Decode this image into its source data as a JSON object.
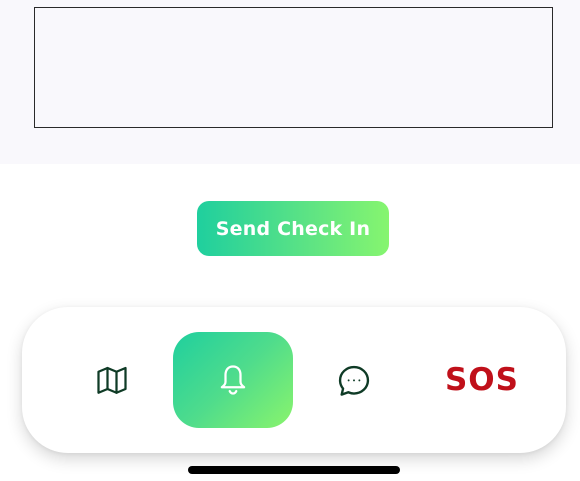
{
  "main": {
    "message_box_text": "",
    "checkin_button_label": "Send Check In"
  },
  "nav": {
    "items": [
      {
        "icon": "map-icon",
        "selected": false
      },
      {
        "icon": "bell-icon",
        "selected": true
      },
      {
        "icon": "chat-bubble-icon",
        "selected": false
      },
      {
        "label": "SOS",
        "selected": false
      }
    ]
  },
  "colors": {
    "accent_gradient_start": "#1fcf9e",
    "accent_gradient_end": "#86f56f",
    "sos_red": "#c0101a",
    "icon_dark_green": "#0f3b26"
  }
}
